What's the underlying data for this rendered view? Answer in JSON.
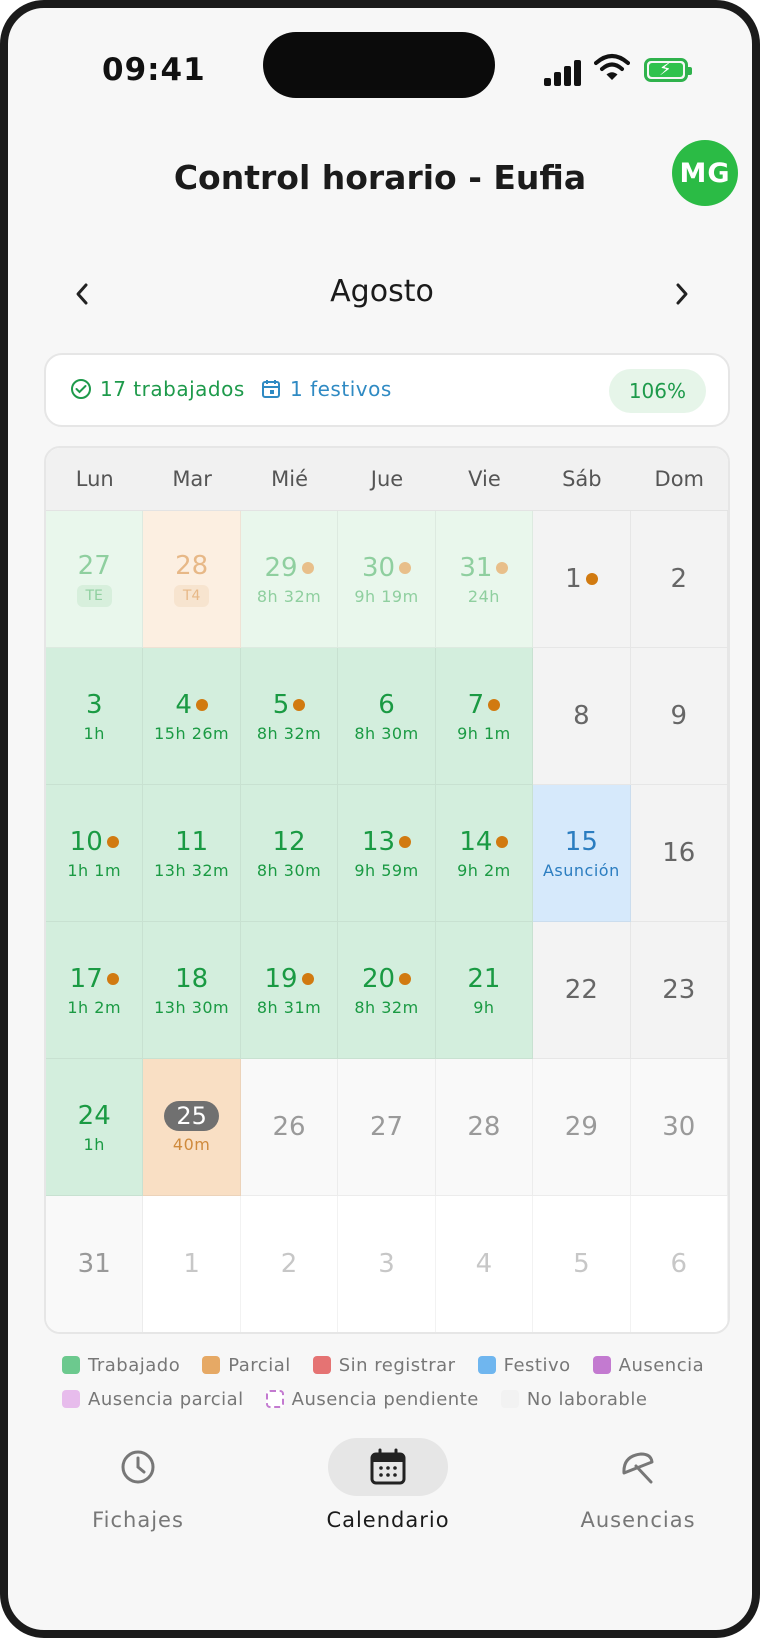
{
  "status_bar": {
    "time": "09:41"
  },
  "header": {
    "title": "Control horario - Eufia",
    "avatar_initials": "MG"
  },
  "month": {
    "title": "Agosto"
  },
  "summary": {
    "worked": "17 trabajados",
    "holidays": "1 festivos",
    "percent": "106%"
  },
  "weekdays": [
    "Lun",
    "Mar",
    "Mié",
    "Jue",
    "Vie",
    "Sáb",
    "Dom"
  ],
  "days": [
    {
      "n": "27",
      "sub": "TE",
      "tag": true,
      "t": "work-light"
    },
    {
      "n": "28",
      "sub": "T4",
      "tag": true,
      "t": "partial-light"
    },
    {
      "n": "29",
      "sub": "8h 32m",
      "dot": "light",
      "t": "work-light"
    },
    {
      "n": "30",
      "sub": "9h 19m",
      "dot": "light",
      "t": "work-light"
    },
    {
      "n": "31",
      "sub": "24h",
      "dot": "light",
      "t": "work-light"
    },
    {
      "n": "1",
      "dot": "dark",
      "t": "off"
    },
    {
      "n": "2",
      "t": "off"
    },
    {
      "n": "3",
      "sub": "1h",
      "t": "work"
    },
    {
      "n": "4",
      "sub": "15h 26m",
      "dot": "dark",
      "t": "work"
    },
    {
      "n": "5",
      "sub": "8h 32m",
      "dot": "dark",
      "t": "work"
    },
    {
      "n": "6",
      "sub": "8h 30m",
      "t": "work"
    },
    {
      "n": "7",
      "sub": "9h 1m",
      "dot": "dark",
      "t": "work"
    },
    {
      "n": "8",
      "t": "off"
    },
    {
      "n": "9",
      "t": "off"
    },
    {
      "n": "10",
      "sub": "1h 1m",
      "dot": "dark",
      "t": "work"
    },
    {
      "n": "11",
      "sub": "13h 32m",
      "t": "work"
    },
    {
      "n": "12",
      "sub": "8h 30m",
      "t": "work"
    },
    {
      "n": "13",
      "sub": "9h 59m",
      "dot": "dark",
      "t": "work"
    },
    {
      "n": "14",
      "sub": "9h 2m",
      "dot": "dark",
      "t": "work"
    },
    {
      "n": "15",
      "sub": "Asunción",
      "t": "hol"
    },
    {
      "n": "16",
      "t": "off"
    },
    {
      "n": "17",
      "sub": "1h 2m",
      "dot": "dark",
      "t": "work"
    },
    {
      "n": "18",
      "sub": "13h 30m",
      "t": "work"
    },
    {
      "n": "19",
      "sub": "8h 31m",
      "dot": "dark",
      "t": "work"
    },
    {
      "n": "20",
      "sub": "8h 32m",
      "dot": "dark",
      "t": "work"
    },
    {
      "n": "21",
      "sub": "9h",
      "t": "work"
    },
    {
      "n": "22",
      "t": "off"
    },
    {
      "n": "23",
      "t": "off"
    },
    {
      "n": "24",
      "sub": "1h",
      "t": "work"
    },
    {
      "n": "25",
      "sub": "40m",
      "today": true,
      "t": "partial"
    },
    {
      "n": "26",
      "t": "future"
    },
    {
      "n": "27",
      "t": "future"
    },
    {
      "n": "28",
      "t": "future"
    },
    {
      "n": "29",
      "t": "future"
    },
    {
      "n": "30",
      "t": "future"
    },
    {
      "n": "31",
      "t": "next-first"
    },
    {
      "n": "1",
      "t": "next"
    },
    {
      "n": "2",
      "t": "next"
    },
    {
      "n": "3",
      "t": "next"
    },
    {
      "n": "4",
      "t": "next"
    },
    {
      "n": "5",
      "t": "next"
    },
    {
      "n": "6",
      "t": "next"
    }
  ],
  "legend": [
    {
      "label": "Trabajado",
      "color": "#6cc98e"
    },
    {
      "label": "Parcial",
      "color": "#e6a965"
    },
    {
      "label": "Sin registrar",
      "color": "#e57373"
    },
    {
      "label": "Festivo",
      "color": "#6fb6ef"
    },
    {
      "label": "Ausencia",
      "color": "#c37ad0"
    },
    {
      "label": "Ausencia parcial",
      "color": "#e7bcec"
    },
    {
      "label": "Ausencia pendiente",
      "color": "#ffffff",
      "dashed": true
    },
    {
      "label": "No laborable",
      "color": "#f2f2f2"
    }
  ],
  "tabs": [
    {
      "label": "Fichajes",
      "icon": "clock-icon"
    },
    {
      "label": "Calendario",
      "icon": "calendar-icon",
      "active": true
    },
    {
      "label": "Ausencias",
      "icon": "umbrella-icon"
    }
  ]
}
